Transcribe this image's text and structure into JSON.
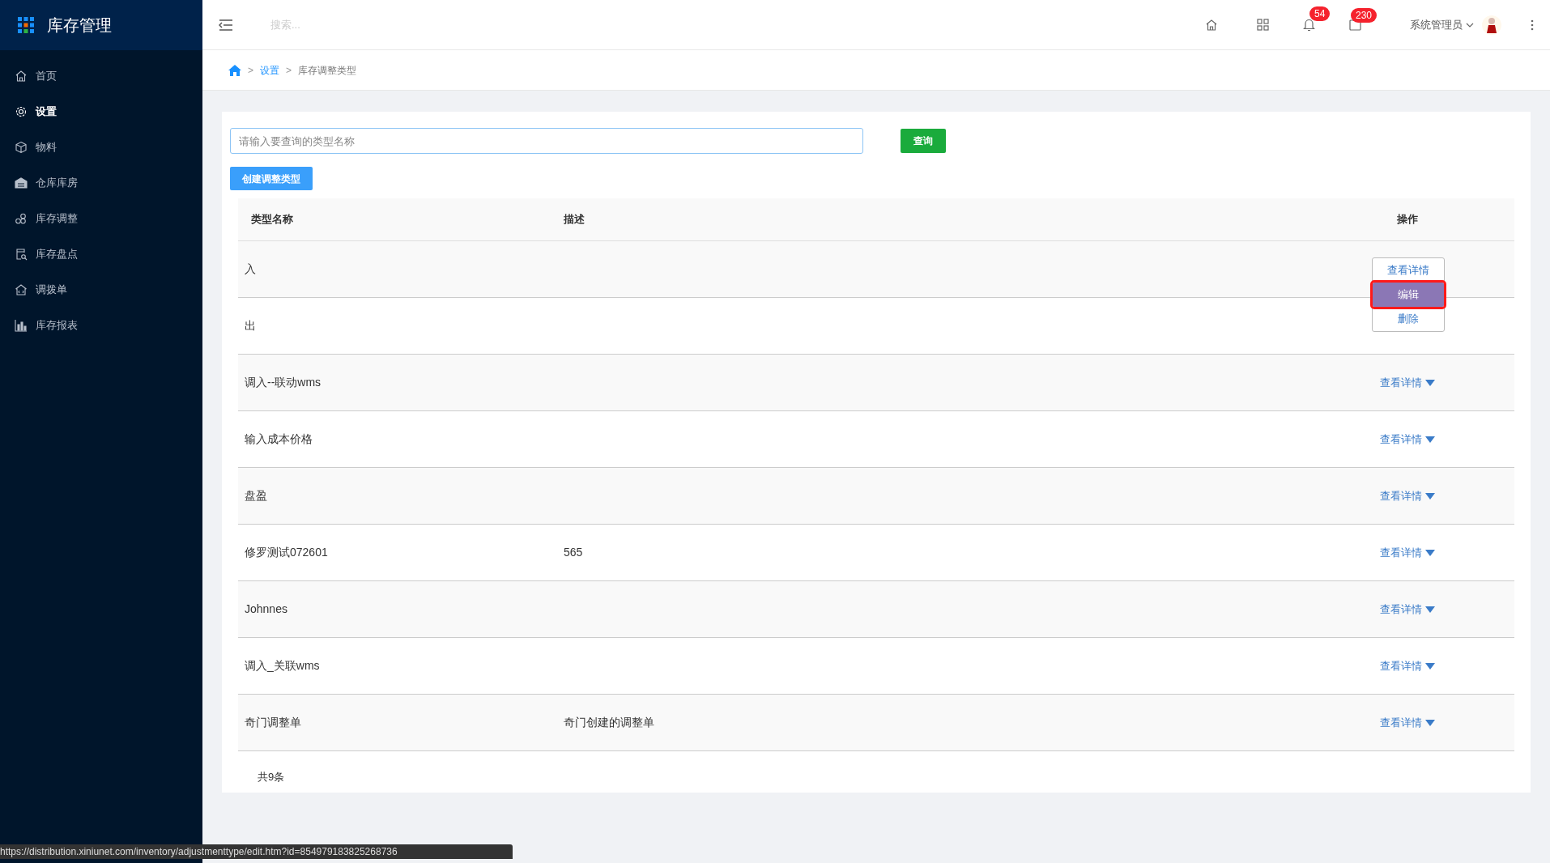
{
  "app": {
    "title": "库存管理"
  },
  "sidebar": {
    "items": [
      {
        "label": "首页",
        "selected": false
      },
      {
        "label": "设置",
        "selected": true
      },
      {
        "label": "物料",
        "selected": false
      },
      {
        "label": "仓库库房",
        "selected": false
      },
      {
        "label": "库存调整",
        "selected": false
      },
      {
        "label": "库存盘点",
        "selected": false
      },
      {
        "label": "调拨单",
        "selected": false
      },
      {
        "label": "库存报表",
        "selected": false
      }
    ]
  },
  "header": {
    "search": {
      "placeholder": "搜索..."
    },
    "notifications": "54",
    "messages": "230",
    "user": "系统管理员"
  },
  "breadcrumb": [
    {
      "separator": ">",
      "label": "设置"
    },
    {
      "separator": ">",
      "label": "库存调整类型"
    }
  ],
  "filter": {
    "placeholder": "请输入要查询的类型名称",
    "query_button": "查询",
    "create_button": "创建调整类型"
  },
  "table": {
    "columns": [
      "类型名称",
      "描述",
      "操作"
    ],
    "rows": [
      {
        "name": "入",
        "description": ""
      },
      {
        "name": "出",
        "description": ""
      },
      {
        "name": "调入--联动wms",
        "description": "",
        "action": "查看详情"
      },
      {
        "name": "输入成本价格",
        "description": "",
        "action": "查看详情"
      },
      {
        "name": "盘盈",
        "description": "",
        "action": "查看详情"
      },
      {
        "name": "修罗测试072601",
        "description": "565",
        "action": "查看详情"
      },
      {
        "name": "Johnnes",
        "description": "",
        "action": "查看详情"
      },
      {
        "name": "调入_关联wms",
        "description": "",
        "action": "查看详情"
      },
      {
        "name": "奇门调整单",
        "description": "奇门创建的调整单",
        "action": "查看详情"
      }
    ],
    "total": "共9条"
  },
  "action_menu": {
    "items": [
      {
        "label": "查看详情",
        "selected": false
      },
      {
        "label": "编辑",
        "selected": true
      },
      {
        "label": "删除",
        "selected": false
      }
    ]
  },
  "status_bar": {
    "url": "https://distribution.xiniunet.com/inventory/adjustmenttype/edit.htm?id=854979183825268736"
  }
}
